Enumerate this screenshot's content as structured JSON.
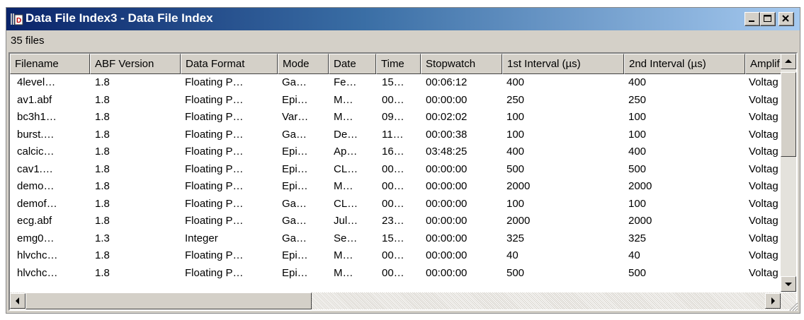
{
  "window": {
    "title": "Data File Index3 - Data File Index",
    "app_icon": "data-file-index-icon",
    "controls": {
      "minimize": "minimize-icon",
      "maximize": "maximize-icon",
      "close": "close-icon"
    }
  },
  "status": {
    "file_count": "35 files"
  },
  "table": {
    "columns": [
      "Filename",
      "ABF Version",
      "Data Format",
      "Mode",
      "Date",
      "Time",
      "Stopwatch",
      "1st Interval (µs)",
      "2nd Interval (µs)",
      "Amplif"
    ],
    "rows": [
      [
        "4level…",
        "1.8",
        "Floating P…",
        "Ga…",
        "Fe…",
        "15…",
        "00:06:12",
        "400",
        "400",
        "Voltag"
      ],
      [
        "av1.abf",
        "1.8",
        "Floating P…",
        "Epi…",
        "M…",
        "00…",
        "00:00:00",
        "250",
        "250",
        "Voltag"
      ],
      [
        "bc3h1…",
        "1.8",
        "Floating P…",
        "Var…",
        "M…",
        "09…",
        "00:02:02",
        "100",
        "100",
        "Voltag"
      ],
      [
        "burst.…",
        "1.8",
        "Floating P…",
        "Ga…",
        "De…",
        "11…",
        "00:00:38",
        "100",
        "100",
        "Voltag"
      ],
      [
        "calcic…",
        "1.8",
        "Floating P…",
        "Epi…",
        "Ap…",
        "16…",
        "03:48:25",
        "400",
        "400",
        "Voltag"
      ],
      [
        "cav1.…",
        "1.8",
        "Floating P…",
        "Epi…",
        "CL…",
        "00…",
        "00:00:00",
        "500",
        "500",
        "Voltag"
      ],
      [
        "demo…",
        "1.8",
        "Floating P…",
        "Epi…",
        "M…",
        "00…",
        "00:00:00",
        "2000",
        "2000",
        "Voltag"
      ],
      [
        "demof…",
        "1.8",
        "Floating P…",
        "Ga…",
        "CL…",
        "00…",
        "00:00:00",
        "100",
        "100",
        "Voltag"
      ],
      [
        "ecg.abf",
        "1.8",
        "Floating P…",
        "Ga…",
        "Jul…",
        "23…",
        "00:00:00",
        "2000",
        "2000",
        "Voltag"
      ],
      [
        "emg0…",
        "1.3",
        "Integer",
        "Ga…",
        "Se…",
        "15…",
        "00:00:00",
        "325",
        "325",
        "Voltag"
      ],
      [
        "hlvchc…",
        "1.8",
        "Floating P…",
        "Epi…",
        "M…",
        "00…",
        "00:00:00",
        "40",
        "40",
        "Voltag"
      ],
      [
        "hlvchc…",
        "1.8",
        "Floating P…",
        "Epi…",
        "M…",
        "00…",
        "00:00:00",
        "500",
        "500",
        "Voltag"
      ]
    ]
  },
  "colors": {
    "titlebar_start": "#0a246a",
    "titlebar_end": "#a6caf0",
    "face": "#d4d0c8"
  }
}
